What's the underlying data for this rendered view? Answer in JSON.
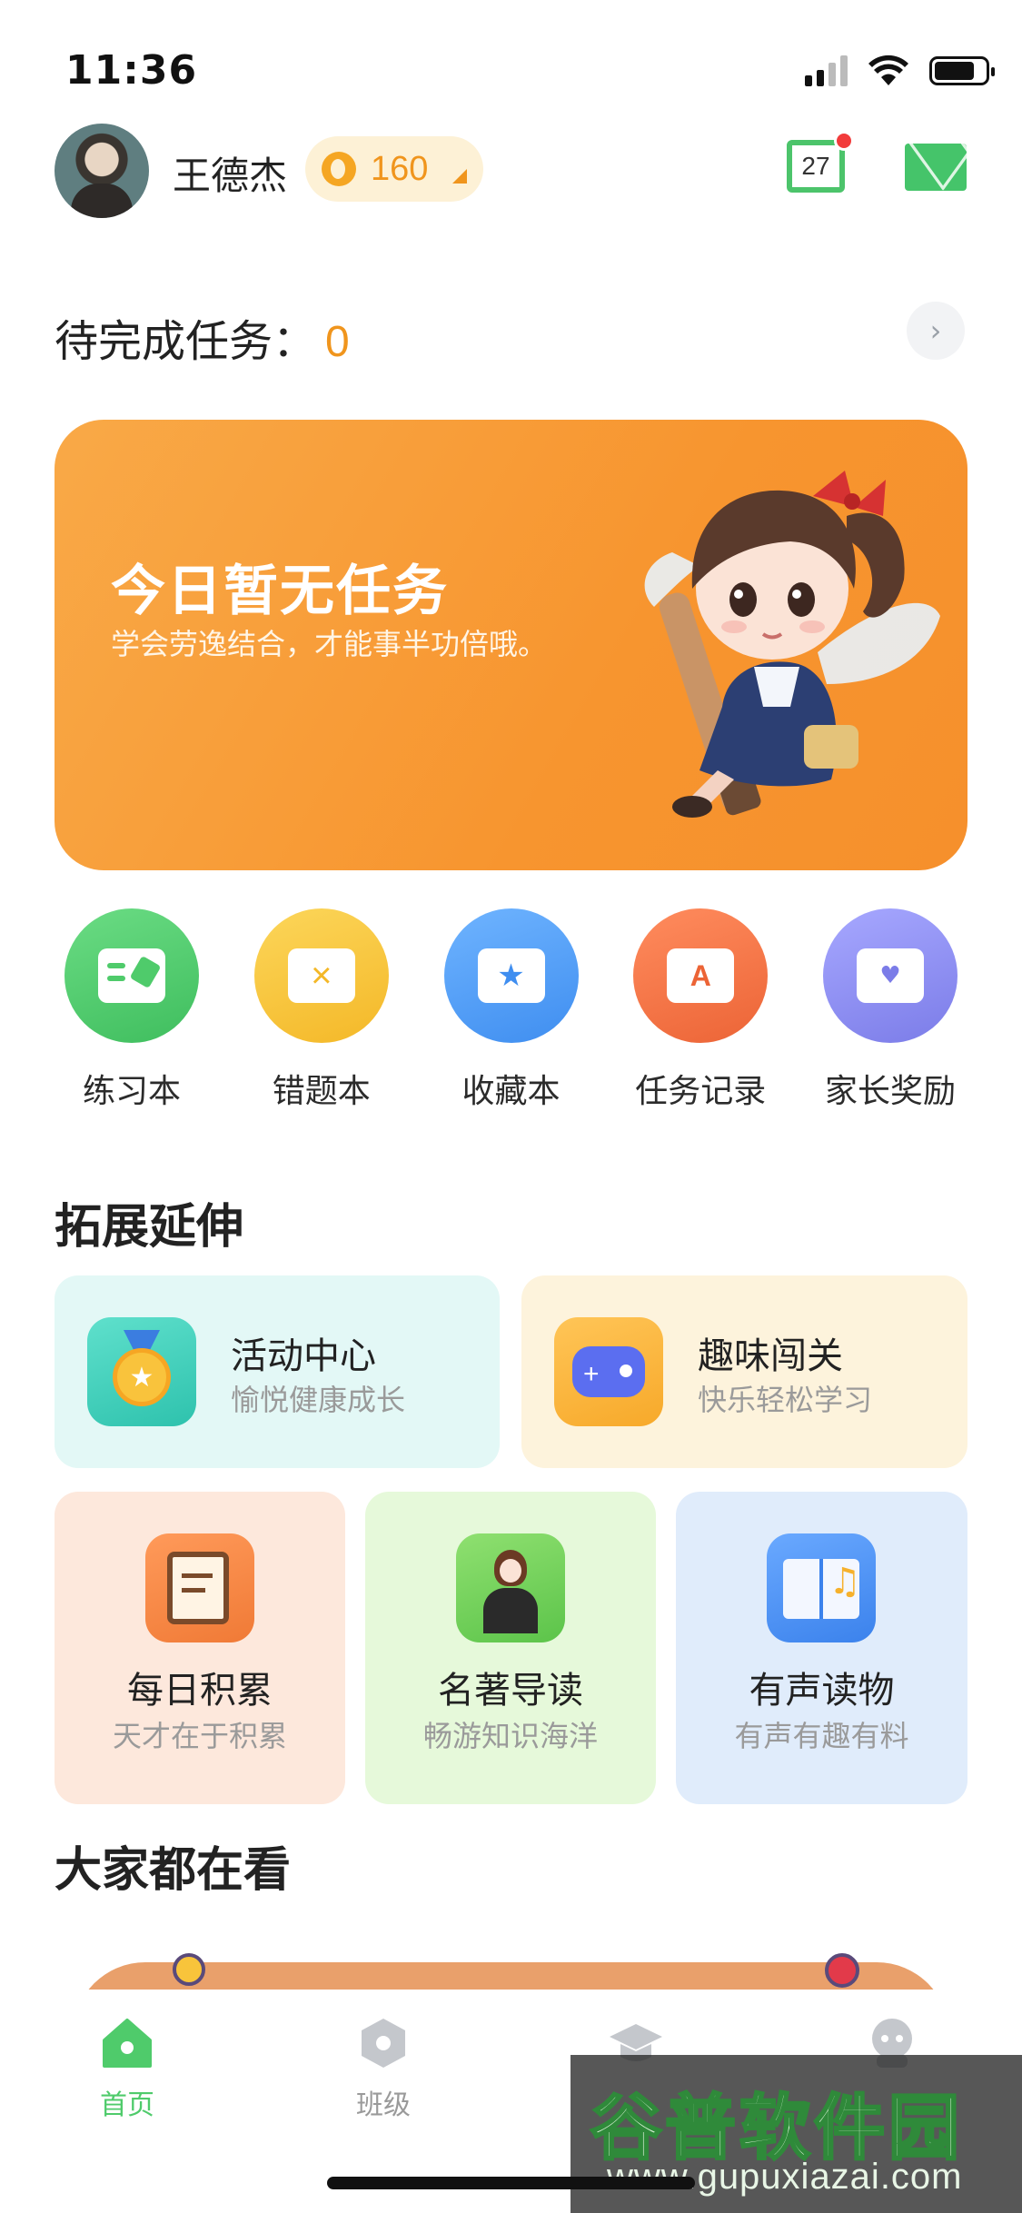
{
  "status_bar": {
    "time": "11:36"
  },
  "header": {
    "username": "王德杰",
    "coins": "160",
    "calendar_day": "27"
  },
  "pending": {
    "label": "待完成任务：",
    "count": "0"
  },
  "banner": {
    "title": "今日暂无任务",
    "subtitle": "学会劳逸结合，才能事半功倍哦。"
  },
  "quick_actions": [
    {
      "label": "练习本",
      "color": "#4fcb6b"
    },
    {
      "label": "错题本",
      "color": "#f8c43b"
    },
    {
      "label": "收藏本",
      "color": "#4f9ef5"
    },
    {
      "label": "任务记录",
      "color": "#f2764a"
    },
    {
      "label": "家长奖励",
      "color": "#8e8ff2"
    }
  ],
  "sections": {
    "extension": "拓展延伸",
    "popular": "大家都在看"
  },
  "extension_cards": [
    {
      "title": "活动中心",
      "subtitle": "愉悦健康成长",
      "bg": "#e3f8f6"
    },
    {
      "title": "趣味闯关",
      "subtitle": "快乐轻松学习",
      "bg": "#fdf3dc"
    },
    {
      "title": "每日积累",
      "subtitle": "天才在于积累",
      "bg": "#fde8dc"
    },
    {
      "title": "名著导读",
      "subtitle": "畅游知识海洋",
      "bg": "#e6f9da"
    },
    {
      "title": "有声读物",
      "subtitle": "有声有趣有料",
      "bg": "#e0ecfb"
    }
  ],
  "tabs": [
    {
      "label": "首页",
      "active": true
    },
    {
      "label": "班级",
      "active": false
    },
    {
      "label": "",
      "active": false
    },
    {
      "label": "",
      "active": false
    }
  ],
  "watermark": {
    "title": "谷普软件园",
    "url": "www.gupuxiazai.com"
  },
  "colors": {
    "accent_green": "#4fcb6b",
    "accent_orange": "#f0951d",
    "banner_orange": "#f7952f"
  }
}
